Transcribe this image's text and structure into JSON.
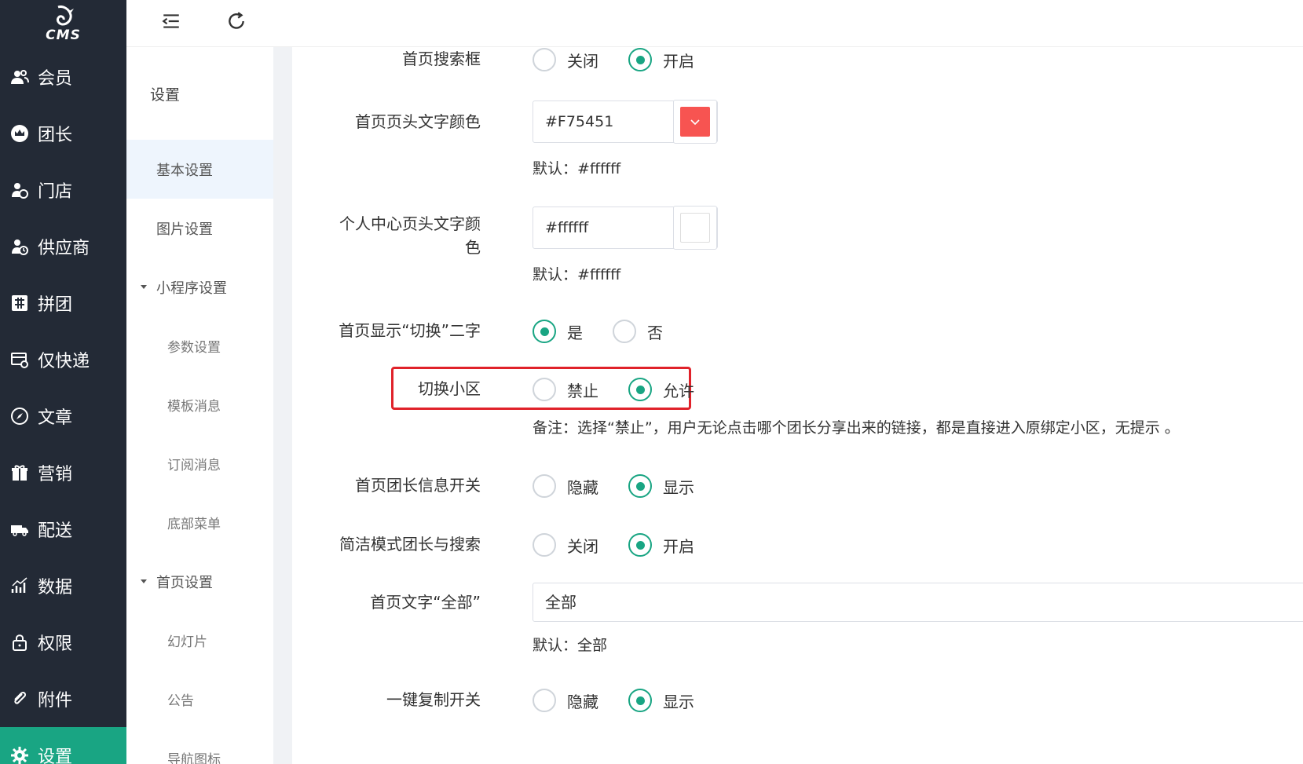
{
  "logo": {
    "text": "CMS"
  },
  "sidebar": {
    "items": [
      {
        "label": "会员",
        "icon": "users-icon"
      },
      {
        "label": "团长",
        "icon": "crown-icon"
      },
      {
        "label": "门店",
        "icon": "store-user-icon"
      },
      {
        "label": "供应商",
        "icon": "supplier-icon"
      },
      {
        "label": "拼团",
        "icon": "group-buy-icon"
      },
      {
        "label": "仅快递",
        "icon": "express-icon"
      },
      {
        "label": "文章",
        "icon": "compass-icon"
      },
      {
        "label": "营销",
        "icon": "gift-icon"
      },
      {
        "label": "配送",
        "icon": "truck-icon"
      },
      {
        "label": "数据",
        "icon": "chart-icon"
      },
      {
        "label": "权限",
        "icon": "lock-icon"
      },
      {
        "label": "附件",
        "icon": "paperclip-icon"
      },
      {
        "label": "设置",
        "icon": "gear-icon",
        "active": true
      }
    ]
  },
  "topbar": {
    "menu_icon": "menu-fold-icon",
    "refresh_icon": "refresh-icon"
  },
  "subnav": {
    "title": "设置",
    "items": [
      {
        "label": "基本设置"
      },
      {
        "label": "图片设置"
      },
      {
        "label": "小程序设置"
      },
      {
        "label": "参数设置"
      },
      {
        "label": "模板消息"
      },
      {
        "label": "订阅消息"
      },
      {
        "label": "底部菜单"
      },
      {
        "label": "首页设置"
      },
      {
        "label": "幻灯片"
      },
      {
        "label": "公告"
      },
      {
        "label": "导航图标"
      }
    ]
  },
  "form": {
    "search_box": {
      "label": "首页搜索框",
      "options": [
        "关闭",
        "开启"
      ],
      "selected": 1
    },
    "header_color": {
      "label": "首页页头文字颜色",
      "value": "#F75451",
      "swatch": "#F75451",
      "hint": "默认：#ffffff"
    },
    "center_color": {
      "label_line1": "个人中心页头文字颜",
      "label_line2": "色",
      "value": "#ffffff",
      "swatch": "#ffffff",
      "hint": "默认：#ffffff"
    },
    "show_switch": {
      "label": "首页显示“切换”二字",
      "options": [
        "是",
        "否"
      ],
      "selected": 0
    },
    "switch_community": {
      "label": "切换小区",
      "options": [
        "禁止",
        "允许"
      ],
      "selected": 1,
      "note": "备注：选择“禁止”，用户无论点击哪个团长分享出来的链接，都是直接进入原绑定小区，无提示 。"
    },
    "leader_info": {
      "label": "首页团长信息开关",
      "options": [
        "隐藏",
        "显示"
      ],
      "selected": 1
    },
    "simple_mode": {
      "label": "简洁模式团长与搜索",
      "options": [
        "关闭",
        "开启"
      ],
      "selected": 1
    },
    "all_text": {
      "label": "首页文字“全部”",
      "value": "全部",
      "hint": "默认：全部"
    },
    "copy_switch": {
      "label": "一键复制开关",
      "options": [
        "隐藏",
        "显示"
      ],
      "selected": 1
    }
  },
  "colors": {
    "sidebar_bg": "#232a36",
    "accent": "#19a583",
    "highlight": "#e0222a"
  }
}
